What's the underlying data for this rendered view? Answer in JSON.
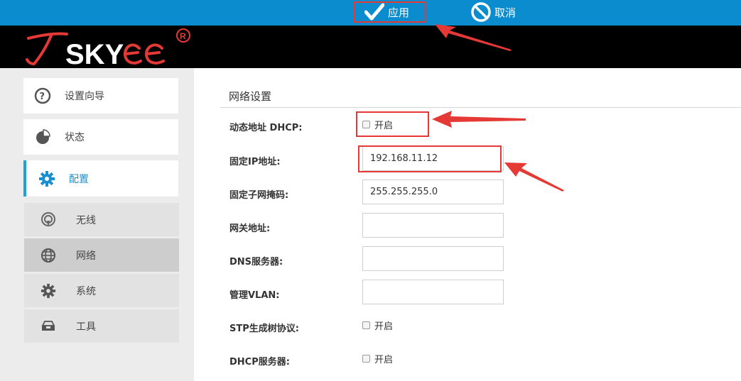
{
  "toolbar": {
    "apply_label": "应用",
    "cancel_label": "取消",
    "apply_icon": "checkmark-icon",
    "cancel_icon": "cancel-circle-icon",
    "background_color": "#0a8ccf"
  },
  "logo": {
    "text": "TSKYEE",
    "registered_mark": "®"
  },
  "sidebar": {
    "main_items": [
      {
        "label": "设置向导",
        "icon": "question-circle-icon"
      },
      {
        "label": "状态",
        "icon": "pie-chart-icon"
      },
      {
        "label": "配置",
        "icon": "gear-icon",
        "active": true
      }
    ],
    "sub_items": [
      {
        "label": "无线",
        "icon": "wireless-icon"
      },
      {
        "label": "网络",
        "icon": "globe-icon",
        "selected": true
      },
      {
        "label": "系统",
        "icon": "gear-icon"
      },
      {
        "label": "工具",
        "icon": "toolbox-icon"
      }
    ],
    "active_color": "#1aa3d8"
  },
  "main": {
    "section_title": "网络设置",
    "fields": {
      "dhcp_label": "动态地址 DHCP:",
      "dhcp_option": "开启",
      "static_ip_label": "固定IP地址:",
      "static_ip_value": "192.168.11.12",
      "subnet_label": "固定子网掩码:",
      "subnet_value": "255.255.255.0",
      "gateway_label": "网关地址:",
      "gateway_value": "",
      "dns_label": "DNS服务器:",
      "dns_value": "",
      "vlan_label": "管理VLAN:",
      "vlan_value": "",
      "stp_label": "STP生成树协议:",
      "stp_option": "开启",
      "dhcp_server_label": "DHCP服务器:",
      "dhcp_server_option": "开启"
    }
  },
  "annotation_color": "#e53935"
}
